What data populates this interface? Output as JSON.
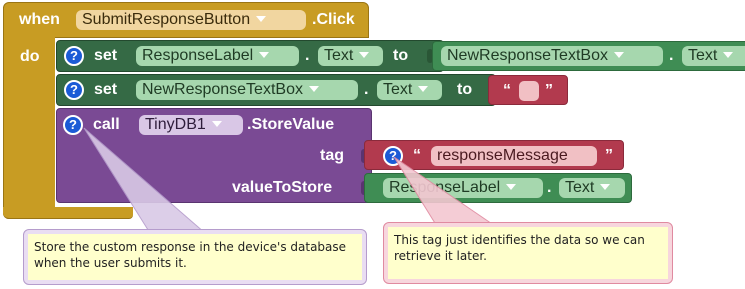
{
  "event_block": {
    "when_label": "when",
    "component": "SubmitResponseButton",
    "event": ".Click",
    "do_label": "do"
  },
  "statement1": {
    "help": "?",
    "set_label": "set",
    "component": "ResponseLabel",
    "property": "Text",
    "to_label": "to",
    "value_component": "NewResponseTextBox",
    "value_property": "Text"
  },
  "statement2": {
    "help": "?",
    "set_label": "set",
    "component": "NewResponseTextBox",
    "property": "Text",
    "to_label": "to",
    "open_quote": "“",
    "close_quote": "”"
  },
  "statement3": {
    "help": "?",
    "call_label": "call",
    "component": "TinyDB1",
    "method": ".StoreValue",
    "tag_label": "tag",
    "tag_help": "?",
    "tag_open_quote": "“",
    "tag_value": "responseMessage",
    "tag_close_quote": "”",
    "value_label": "valueToStore",
    "value_component": "ResponseLabel",
    "value_property": "Text"
  },
  "comments": {
    "call_comment": "Store the custom response in the device's database when the user submits it.",
    "tag_comment": "This tag just identifies the data so we can retrieve it later."
  },
  "colors": {
    "event_block": "#c89c23",
    "setter_block": "#356a45",
    "getter_block": "#3f8d54",
    "call_block": "#7a4a94",
    "text_block": "#b23a4e",
    "help_icon": "#1b5bd6",
    "comment_bg": "#ffffcc"
  }
}
